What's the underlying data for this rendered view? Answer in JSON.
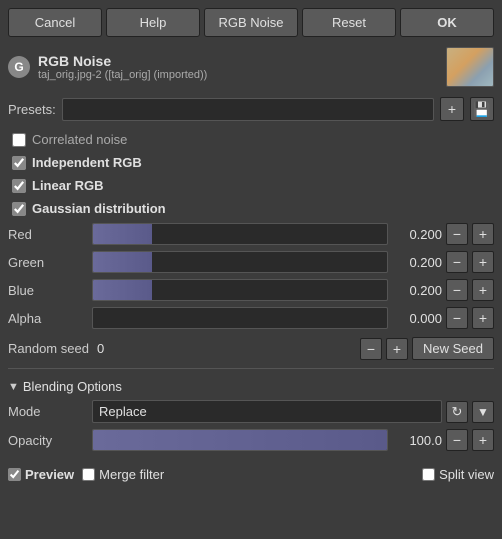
{
  "toolbar": {
    "cancel_label": "Cancel",
    "help_label": "Help",
    "rgb_noise_label": "RGB Noise",
    "reset_label": "Reset",
    "ok_label": "OK"
  },
  "header": {
    "logo_letter": "G",
    "title": "RGB Noise",
    "subtitle": "taj_orig.jpg-2 ([taj_orig] (imported))"
  },
  "presets": {
    "label": "Presets:",
    "value": "",
    "placeholder": "",
    "add_label": "+",
    "save_label": "💾"
  },
  "options": {
    "correlated_noise_label": "Correlated noise",
    "correlated_noise_checked": false,
    "independent_rgb_label": "Independent RGB",
    "independent_rgb_checked": true,
    "linear_rgb_label": "Linear RGB",
    "linear_rgb_checked": true,
    "gaussian_label": "Gaussian distribution",
    "gaussian_checked": true
  },
  "sliders": {
    "red": {
      "label": "Red",
      "value": "0.200",
      "fill_pct": 20
    },
    "green": {
      "label": "Green",
      "value": "0.200",
      "fill_pct": 20
    },
    "blue": {
      "label": "Blue",
      "value": "0.200",
      "fill_pct": 20
    },
    "alpha": {
      "label": "Alpha",
      "value": "0.000",
      "fill_pct": 0
    }
  },
  "seed": {
    "label": "Random seed",
    "value": "0",
    "new_seed_label": "New Seed"
  },
  "blending": {
    "section_label": "Blending Options",
    "mode_label": "Mode",
    "mode_value": "Replace",
    "opacity_label": "Opacity",
    "opacity_value": "100.0"
  },
  "bottom": {
    "preview_label": "Preview",
    "preview_checked": true,
    "merge_label": "Merge filter",
    "merge_checked": false,
    "split_label": "Split view",
    "split_checked": false
  }
}
